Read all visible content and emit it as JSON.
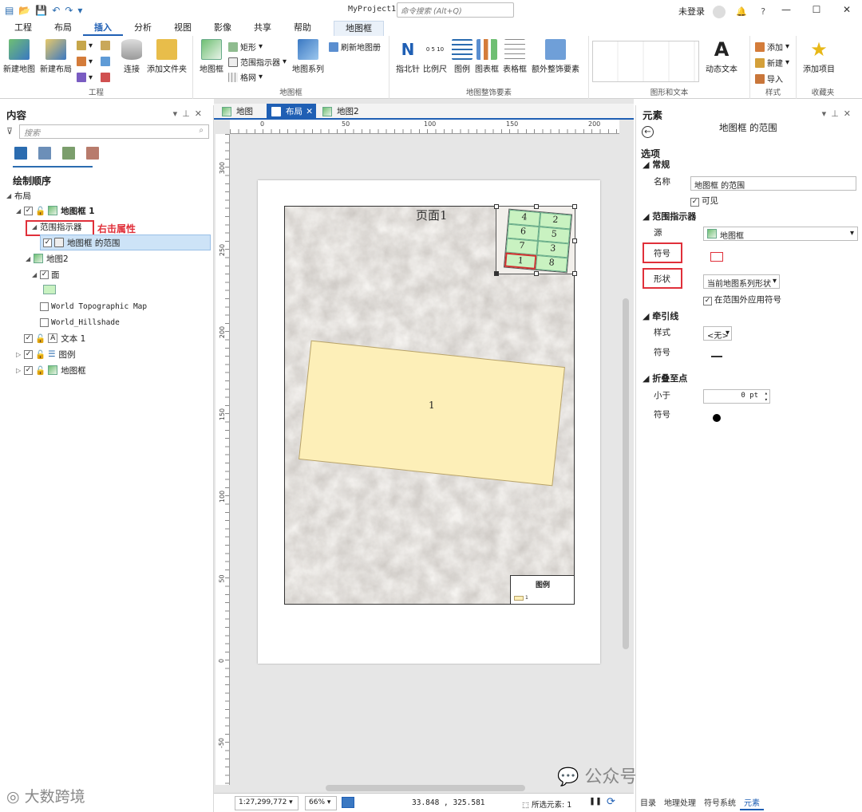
{
  "titlebar": {
    "project": "MyProject1",
    "search_placeholder": "命令搜索 (Alt+Q)",
    "user": "未登录",
    "help": "?"
  },
  "ribbon_tabs": [
    "工程",
    "布局",
    "插入",
    "分析",
    "视图",
    "影像",
    "共享",
    "帮助"
  ],
  "active_tab": "插入",
  "context_tab": "地图框",
  "ribbon": {
    "project_group": {
      "label": "工程",
      "new_map": "新建地图",
      "new_layout": "新建布局",
      "connect": "连接",
      "add_folder": "添加文件夹"
    },
    "mapframe_group": {
      "label": "地图框",
      "map_frame": "地图框",
      "rectangle": "矩形",
      "extent_indicator": "范围指示器",
      "grid": "格网",
      "map_series": "地图系列",
      "refresh_atlas": "刷新地图册"
    },
    "surround_group": {
      "label": "地图整饰要素",
      "north_arrow": "指北针",
      "scale_bar": "比例尺",
      "legend": "图例",
      "chart_frame": "图表框",
      "table_frame": "表格框",
      "extra_elements": "额外整饰要素",
      "scale_ticks": "0  5 10"
    },
    "graphics_group": {
      "label": "图形和文本",
      "dynamic_text": "动态文本"
    },
    "styles_group": {
      "label": "样式",
      "add": "添加",
      "new": "新建",
      "import": "导入"
    },
    "favorites_group": {
      "label": "收藏夹",
      "add_item": "添加项目"
    }
  },
  "contents": {
    "title": "内容",
    "search_placeholder": "搜索",
    "drawing_order": "绘制顺序",
    "items": {
      "layout": "布局",
      "mapframe1": "地图框 1",
      "extent_indicator": "范围指示器",
      "annotation": "右击属性",
      "extent_item": "地图框 的范围",
      "map2": "地图2",
      "face": "面",
      "topo": "World Topographic Map",
      "hillshade": "World_Hillshade",
      "text1": "文本 1",
      "legend": "图例",
      "mapframe": "地图框"
    }
  },
  "doc_tabs": [
    "地图",
    "布局",
    "地图2"
  ],
  "active_doc_tab": "布局",
  "ruler_h": [
    "0",
    "50",
    "100",
    "150",
    "200"
  ],
  "ruler_v": [
    "300",
    "250",
    "200",
    "150",
    "100",
    "50",
    "0",
    "-50"
  ],
  "layout_page": {
    "title": "页面1",
    "main_label": "1",
    "legend_title": "图例",
    "legend_item": "1",
    "inset_cells": [
      "4",
      "2",
      "6",
      "5",
      "7",
      "3",
      "1",
      "8"
    ]
  },
  "status": {
    "scale": "1:27,299,772",
    "zoom": "66%",
    "coords": "33.848 , 325.581",
    "selected": "所选元素: 1"
  },
  "element_pane": {
    "title": "元素",
    "subtitle": "地图框 的范围",
    "options": "选项",
    "general": "常规",
    "name_label": "名称",
    "name_value": "地图框 的范围",
    "visible": "可见",
    "extent_section": "范围指示器",
    "source_label": "源",
    "source_value": "地图框",
    "symbol_label": "符号",
    "shape_label": "形状",
    "shape_value": "当前地图系列形状",
    "apply_outside": "在范围外应用符号",
    "leader_section": "牵引线",
    "style_label": "样式",
    "style_value": "<无>",
    "leader_symbol_label": "符号",
    "collapse_section": "折叠至点",
    "less_than_label": "小于",
    "less_than_value": "0 pt",
    "collapse_symbol_label": "符号",
    "bottom_tabs": [
      "目录",
      "地理处理",
      "符号系统",
      "元素"
    ],
    "active_bottom_tab": "元素"
  },
  "watermarks": {
    "left": "大数跨境",
    "right": "公众号 · GISer成长记"
  }
}
